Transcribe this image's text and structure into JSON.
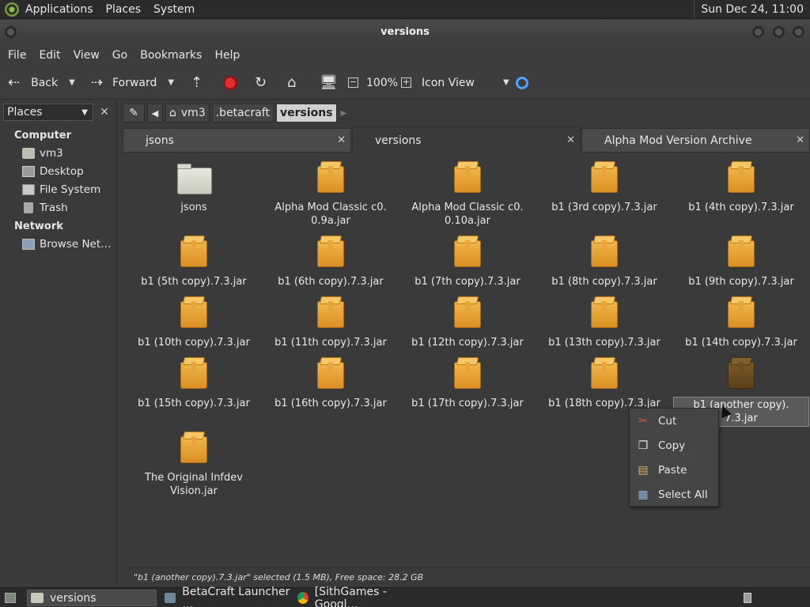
{
  "top_panel": {
    "menus": [
      "Applications",
      "Places",
      "System"
    ],
    "clock": "Sun Dec 24, 11:00"
  },
  "window": {
    "title": "versions"
  },
  "menubar": [
    "File",
    "Edit",
    "View",
    "Go",
    "Bookmarks",
    "Help"
  ],
  "toolbar": {
    "back": "Back",
    "forward": "Forward",
    "zoom": "100%",
    "view_mode": "Icon View"
  },
  "sidebar": {
    "combo": "Places",
    "computer_heading": "Computer",
    "computer_items": [
      "vm3",
      "Desktop",
      "File System",
      "Trash"
    ],
    "network_heading": "Network",
    "network_items": [
      "Browse Net…"
    ]
  },
  "location": {
    "crumbs": [
      "vm3",
      ".betacraft",
      "versions"
    ]
  },
  "tabs": [
    {
      "label": "jsons"
    },
    {
      "label": "versions"
    },
    {
      "label": "Alpha Mod Version Archive"
    }
  ],
  "files": [
    {
      "name": "jsons",
      "type": "folder"
    },
    {
      "name": "Alpha Mod Classic c0.\n0.9a.jar",
      "type": "jar"
    },
    {
      "name": "Alpha Mod Classic c0.\n0.10a.jar",
      "type": "jar"
    },
    {
      "name": "b1 (3rd copy).7.3.jar",
      "type": "jar"
    },
    {
      "name": "b1 (4th copy).7.3.jar",
      "type": "jar"
    },
    {
      "name": "b1 (5th copy).7.3.jar",
      "type": "jar"
    },
    {
      "name": "b1 (6th copy).7.3.jar",
      "type": "jar"
    },
    {
      "name": "b1 (7th copy).7.3.jar",
      "type": "jar"
    },
    {
      "name": "b1 (8th copy).7.3.jar",
      "type": "jar"
    },
    {
      "name": "b1 (9th copy).7.3.jar",
      "type": "jar"
    },
    {
      "name": "b1 (10th copy).7.3.jar",
      "type": "jar"
    },
    {
      "name": "b1 (11th copy).7.3.jar",
      "type": "jar"
    },
    {
      "name": "b1 (12th copy).7.3.jar",
      "type": "jar"
    },
    {
      "name": "b1 (13th copy).7.3.jar",
      "type": "jar"
    },
    {
      "name": "b1 (14th copy).7.3.jar",
      "type": "jar"
    },
    {
      "name": "b1 (15th copy).7.3.jar",
      "type": "jar"
    },
    {
      "name": "b1 (16th copy).7.3.jar",
      "type": "jar"
    },
    {
      "name": "b1 (17th copy).7.3.jar",
      "type": "jar"
    },
    {
      "name": "b1 (18th copy).7.3.jar",
      "type": "jar"
    },
    {
      "name": "b1 (another copy).\n7.3.jar",
      "type": "jar",
      "selected": true
    },
    {
      "name": "The Original Infdev\nVision.jar",
      "type": "jar"
    }
  ],
  "status": "\"b1 (another copy).7.3.jar\" selected (1.5 MB), Free space: 28.2 GB",
  "context_menu": [
    {
      "label": "Cut",
      "icon": "scissors-icon"
    },
    {
      "label": "Copy",
      "icon": "copy-icon"
    },
    {
      "label": "Paste",
      "icon": "paste-icon"
    },
    {
      "label": "Select All",
      "icon": "select-all-icon"
    }
  ],
  "taskbar": [
    {
      "label": "versions",
      "icon": "folder-icon",
      "active": true
    },
    {
      "label": "BetaCraft Launcher …",
      "icon": "java-icon",
      "active": false
    },
    {
      "label": "[SithGames - Googl…",
      "icon": "chrome-icon",
      "active": false
    }
  ]
}
